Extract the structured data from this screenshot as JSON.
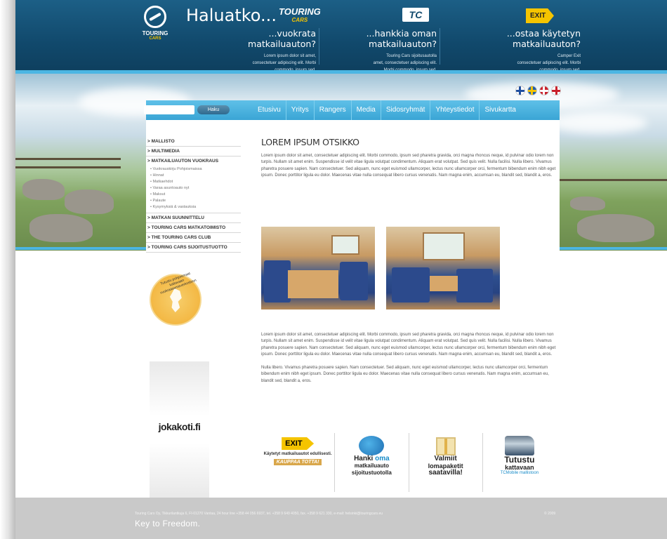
{
  "header": {
    "logo_text": "TOURING",
    "logo_sub": "CARS",
    "headline": "Haluatko...",
    "brand_small": "TOURING",
    "brand_small_sub": "CARS",
    "tc_logo": "TC",
    "exit_logo": "EXIT",
    "columns": [
      {
        "title": "...vuokrata matkailuauton?",
        "text1": "Lorem ipsum dolor sit amet,",
        "text2": "consectetuer adipiscing elit. Morbi",
        "text3": "commodo, ipsum sed."
      },
      {
        "title": "...hankkia oman matkailuauton?",
        "text1": "Touring Cars sijoitusautolla",
        "text2": "amet, consectetuer adipiscing elit.",
        "text3": "Morbi commodo, ipsum sed."
      },
      {
        "title": "...ostaa käytetyn matkailuauton?",
        "text1": "Camper Exit",
        "text2": "consectetuer adipiscing elit. Morbi",
        "text3": "commodo, ipsum sed."
      }
    ]
  },
  "search": {
    "value": "",
    "button": "Haku"
  },
  "nav": [
    "Etusivu",
    "Yritys",
    "Rangers",
    "Media",
    "Sidosryhmät",
    "Yhteystiedot",
    "Sivukartta"
  ],
  "sidebar": {
    "items": [
      {
        "label": "> MALLISTO"
      },
      {
        "label": "> MULTIMEDIA"
      },
      {
        "label": "> MATKAILUAUTON VUOKRAUS"
      }
    ],
    "subitems": [
      "• Vuokrauskirju Pohjoismaissa",
      "• Hinnat",
      "• Matkaehdot",
      "• Varaa asuntoauto nyt",
      "• Maksut",
      "• Palaute",
      "• Kysymyksiä & vastauksia"
    ],
    "items_after": [
      {
        "label": "> MATKAN SUUNNITTELU"
      },
      {
        "label": "> TOURING CARS MATKATOIMISTO"
      },
      {
        "label": "> THE TOURING CARS CLUB"
      },
      {
        "label": "> TOURING CARS SIJOITUSTUOTTO"
      }
    ],
    "badge_text": "Tutustu pohjoismaat kattavaan vuokraasemaverkostoon",
    "ad_text": "jokakoti.fi"
  },
  "main": {
    "title": "LOREM IPSUM OTSIKKO",
    "para1": "Lorem ipsum dolor sit amet, consectetuer adipiscing elit. Morbi commodo, ipsum sed pharetra gravida, orci magna rhoncus neque, id pulvinar odio lorem non turpis. Nullam sit amet enim. Suspendisse id velit vitae ligula volutpat condimentum. Aliquam erat volutpat. Sed quis velit. Nulla facilisi. Nulla libero. Vivamus pharetra posuere sapien. Nam consectetuer. Sed aliquam, nunc eget euismod ullamcorper, lectus nunc ullamcorper orci, fermentum bibendum enim nibh eget ipsum. Donec porttitor ligula eu dolor. Maecenas vitae nulla consequat libero cursus venenatis. Nam magna enim, accumsan eu, blandit sed, blandit a, eros.",
    "para2": "Lorem ipsum dolor sit amet, consectetuer adipiscing elit. Morbi commodo, ipsum sed pharetra gravida, orci magna rhoncus neque, id pulvinar odio lorem non turpis. Nullam sit amet enim. Suspendisse id velit vitae ligula volutpat condimentum. Aliquam erat volutpat. Sed quis velit. Nulla facilisi. Nulla libero. Vivamus pharetra posuere sapien. Nam consectetuer. Sed aliquam, nunc eget euismod ullamcorper, lectus nunc ullamcorper orci, fermentum bibendum enim nibh eget ipsum. Donec porttitor ligula eu dolor. Maecenas vitae nulla consequat libero cursus venenatis. Nam magna enim, accumsan eu, blandit sed, blandit a, eros.",
    "para3": "Nulla libero. Vivamus pharetra posuere sapien. Nam consectetuer. Sed aliquam, nunc eget euismod ullamcorper, lectus nunc ullamcorper orci, fermentum bibendum enim nibh eget ipsum. Donec porttitor ligula eu dolor. Maecenas vitae nulla consequat libero cursus venenatis. Nam magna enim, accumsan eu, blandit sed, blandit a, eros."
  },
  "promos": [
    {
      "exit": "EXIT",
      "sub": "Käytetyt matkailuautot edullisesti.",
      "tag": "KAUPPAA TOTTA!"
    },
    {
      "title1": "Hanki",
      "title_accent": "oma",
      "title2": "matkailuauto",
      "sub": "sijoitustuotolla"
    },
    {
      "title1": "Valmiit",
      "title2": "lomapaketit",
      "title3": "saatavilla!"
    },
    {
      "title1": "Tutustu",
      "title2": "kattavaan",
      "sub": "TCMobile mallistoon"
    }
  ],
  "footer": {
    "address": "Touring Cars Oy, Tikkurilantkuja 6, FI-01270 Vantaa, 24 hour line +358 44 056 6937, tel. +358 9 649 4050, fax. +358 9 621 330, e-mail: helsinki@touringcars.eu",
    "copyright": "© 2009",
    "slogan": "Key to Freedom."
  },
  "colors": {
    "header_blue": "#11496c",
    "accent_blue": "#4bb6e3",
    "nav_blue": "#3aa5d5",
    "exit_yellow": "#f5c400",
    "footer_grey": "#c9c9c9"
  }
}
